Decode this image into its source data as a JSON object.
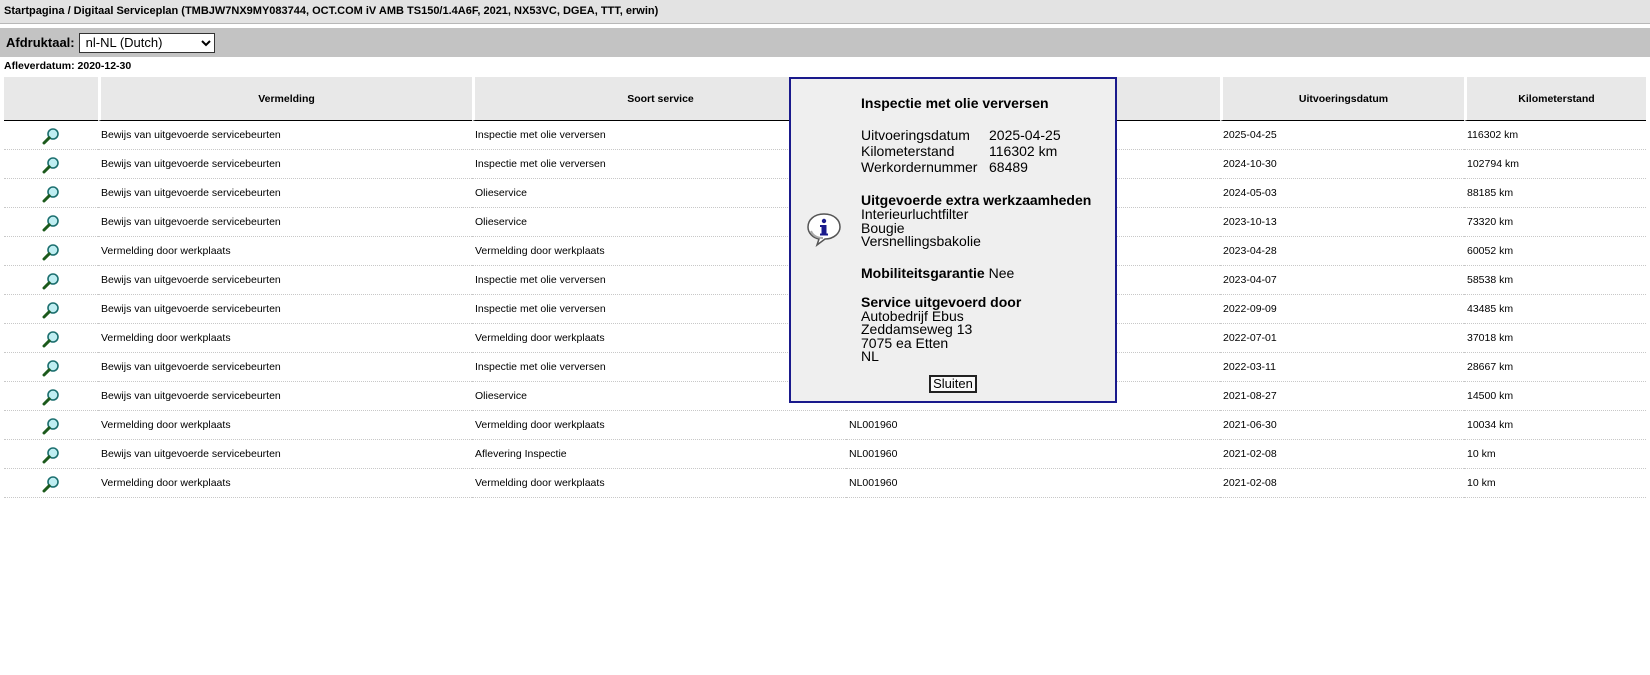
{
  "breadcrumb": "Startpagina / Digitaal Serviceplan (TMBJW7NX9MY083744, OCT.COM iV AMB TS150/1.4A6F, 2021, NX53VC, DGEA, TTT, erwin)",
  "print_language": {
    "label": "Afdruktaal:",
    "selected": "nl-NL (Dutch)"
  },
  "delivery": "Afleverdatum: 2020-12-30",
  "table": {
    "headers": [
      "",
      "Vermelding",
      "Soort service",
      "",
      "Uitvoeringsdatum",
      "Kilometerstand"
    ],
    "rows": [
      {
        "entry": "Bewijs van uitgevoerde servicebeurten",
        "type": "Inspectie met olie verversen",
        "dealer": "",
        "date": "2025-04-25",
        "km": "116302 km"
      },
      {
        "entry": "Bewijs van uitgevoerde servicebeurten",
        "type": "Inspectie met olie verversen",
        "dealer": "",
        "date": "2024-10-30",
        "km": "102794 km"
      },
      {
        "entry": "Bewijs van uitgevoerde servicebeurten",
        "type": "Olieservice",
        "dealer": "",
        "date": "2024-05-03",
        "km": "88185 km"
      },
      {
        "entry": "Bewijs van uitgevoerde servicebeurten",
        "type": "Olieservice",
        "dealer": "",
        "date": "2023-10-13",
        "km": "73320 km"
      },
      {
        "entry": "Vermelding door werkplaats",
        "type": "Vermelding door werkplaats",
        "dealer": "",
        "date": "2023-04-28",
        "km": "60052 km"
      },
      {
        "entry": "Bewijs van uitgevoerde servicebeurten",
        "type": "Inspectie met olie verversen",
        "dealer": "",
        "date": "2023-04-07",
        "km": "58538 km"
      },
      {
        "entry": "Bewijs van uitgevoerde servicebeurten",
        "type": "Inspectie met olie verversen",
        "dealer": "",
        "date": "2022-09-09",
        "km": "43485 km"
      },
      {
        "entry": "Vermelding door werkplaats",
        "type": "Vermelding door werkplaats",
        "dealer": "",
        "date": "2022-07-01",
        "km": "37018 km"
      },
      {
        "entry": "Bewijs van uitgevoerde servicebeurten",
        "type": "Inspectie met olie verversen",
        "dealer": "",
        "date": "2022-03-11",
        "km": "28667 km"
      },
      {
        "entry": "Bewijs van uitgevoerde servicebeurten",
        "type": "Olieservice",
        "dealer": "",
        "date": "2021-08-27",
        "km": "14500 km"
      },
      {
        "entry": "Vermelding door werkplaats",
        "type": "Vermelding door werkplaats",
        "dealer": "NL001960",
        "date": "2021-06-30",
        "km": "10034 km"
      },
      {
        "entry": "Bewijs van uitgevoerde servicebeurten",
        "type": "Aflevering Inspectie",
        "dealer": "NL001960",
        "date": "2021-02-08",
        "km": "10 km"
      },
      {
        "entry": "Vermelding door werkplaats",
        "type": "Vermelding door werkplaats",
        "dealer": "NL001960",
        "date": "2021-02-08",
        "km": "10 km"
      }
    ]
  },
  "popup": {
    "title": "Inspectie met olie verversen",
    "details": [
      {
        "label": "Uitvoeringsdatum",
        "value": "2025-04-25"
      },
      {
        "label": "Kilometerstand",
        "value": "116302 km"
      },
      {
        "label": "Werkordernummer",
        "value": "68489"
      }
    ],
    "extra_heading": "Uitgevoerde extra werkzaamheden",
    "extra_items": [
      "Interieurluchtfilter",
      "Bougie",
      "Versnellingsbakolie"
    ],
    "mobility_label": "Mobiliteitsgarantie",
    "mobility_value": "Nee",
    "service_by_heading": "Service uitgevoerd door",
    "service_by": [
      "Autobedrijf Ebus",
      "Zeddamseweg 13",
      "7075 ea Etten",
      "NL"
    ],
    "close_label": "Sluiten"
  },
  "icons": {
    "row_action": "magnifier-icon",
    "popup": "info-speech-bubble-icon"
  },
  "colors": {
    "popup_border": "#1a1a8c",
    "header_bg": "#e8e8e8",
    "lang_bar_bg": "#c3c3c3"
  }
}
